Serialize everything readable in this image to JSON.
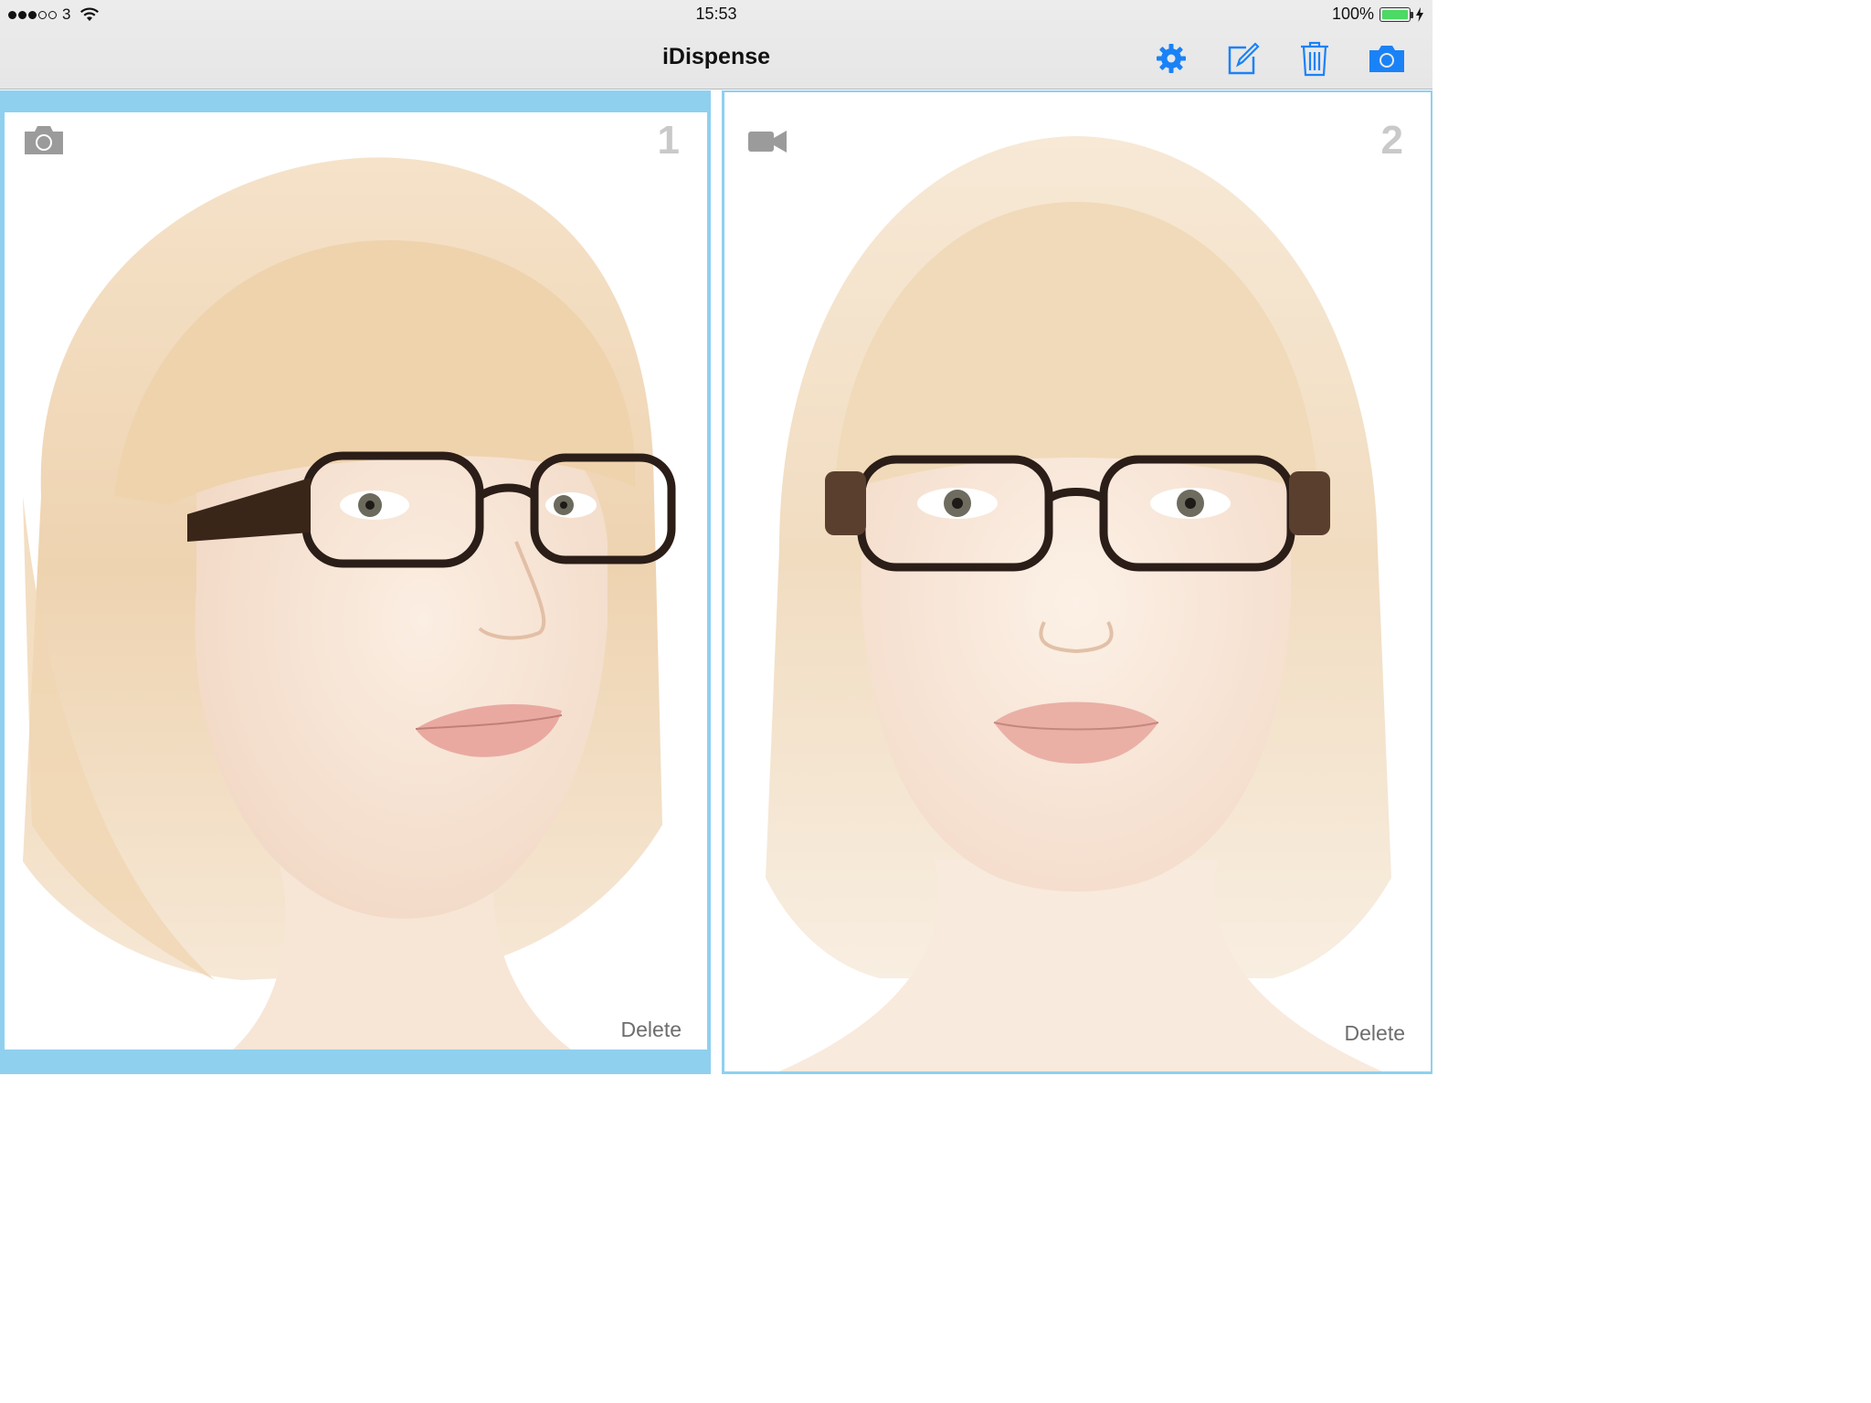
{
  "status_bar": {
    "carrier": "3",
    "time": "15:53",
    "battery_percent": "100%",
    "signal_bars_filled": 3,
    "signal_bars_total": 5,
    "battery_level": 1.0,
    "battery_color": "#4cd964"
  },
  "nav": {
    "title": "iDispense",
    "buttons": [
      {
        "name": "settings",
        "icon": "gear-icon"
      },
      {
        "name": "compose",
        "icon": "compose-icon"
      },
      {
        "name": "delete-all",
        "icon": "trash-icon"
      },
      {
        "name": "camera",
        "icon": "camera-icon"
      }
    ],
    "accent_color": "#1a82f7"
  },
  "panels": [
    {
      "number": "1",
      "media_icon": "camera-icon",
      "delete_label": "Delete",
      "selected": true,
      "frame_color": "#8fd0ef"
    },
    {
      "number": "2",
      "media_icon": "video-icon",
      "delete_label": "Delete",
      "selected": false,
      "frame_color": "#8fd0ef"
    }
  ]
}
